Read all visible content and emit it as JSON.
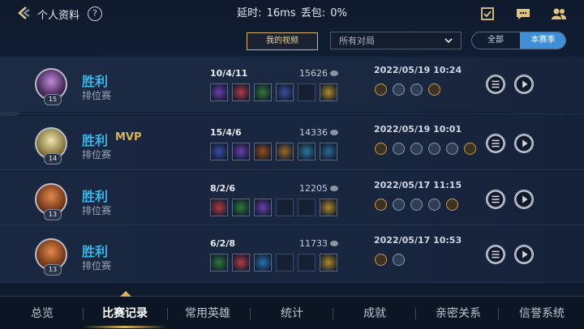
{
  "header": {
    "title": "个人资料",
    "help": "?",
    "latency_label": "延时:",
    "latency_value": "16ms",
    "loss_label": "丢包:",
    "loss_value": "0%",
    "icons": [
      "checklist-icon",
      "chat-icon",
      "friends-icon"
    ]
  },
  "filters": {
    "my_video": "我的视频",
    "match_filter": "所有对局",
    "season_tabs": [
      "全部",
      "本赛季"
    ],
    "active_season_tab": "本赛季"
  },
  "matches": [
    {
      "level": "15",
      "result": "胜利",
      "mvp": "",
      "mode": "排位赛",
      "kda": "10/4/11",
      "gold": "15626",
      "datetime": "2022/05/19 10:24",
      "item_colors": [
        "#6a3fb0",
        "#b23a46",
        "#2f7a3a",
        "#3a4f9a",
        "",
        "#b08a2a"
      ],
      "badge_count": 4
    },
    {
      "level": "14",
      "result": "胜利",
      "mvp": "MVP",
      "mode": "排位赛",
      "kda": "15/4/6",
      "gold": "14336",
      "datetime": "2022/05/19 10:01",
      "item_colors": [
        "#3850a8",
        "#6a3fb0",
        "#9a4a1e",
        "#9a6a2a",
        "#2a7aa0",
        "#2a6a9a"
      ],
      "badge_count": 6
    },
    {
      "level": "13",
      "result": "胜利",
      "mvp": "",
      "mode": "排位赛",
      "kda": "8/2/6",
      "gold": "12205",
      "datetime": "2022/05/17 11:15",
      "item_colors": [
        "#b23a46",
        "#2f7a3a",
        "#6a3fb0",
        "",
        "",
        "#b08a2a"
      ],
      "badge_count": 5
    },
    {
      "level": "13",
      "result": "胜利",
      "mvp": "",
      "mode": "排位赛",
      "kda": "6/2/8",
      "gold": "11733",
      "datetime": "2022/05/17 10:53",
      "item_colors": [
        "#2f7a3a",
        "#b23a46",
        "#2a70b0",
        "",
        "",
        "#b08a2a"
      ],
      "badge_count": 2
    }
  ],
  "bottom_nav": {
    "items": [
      "总览",
      "比赛记录",
      "常用英雄",
      "统计",
      "成就",
      "亲密关系",
      "信誉系统"
    ],
    "active": "比赛记录"
  },
  "colors": {
    "win": "#38b6e8",
    "mvp": "#d8b25a",
    "active_tab": "#3f8fd8"
  }
}
